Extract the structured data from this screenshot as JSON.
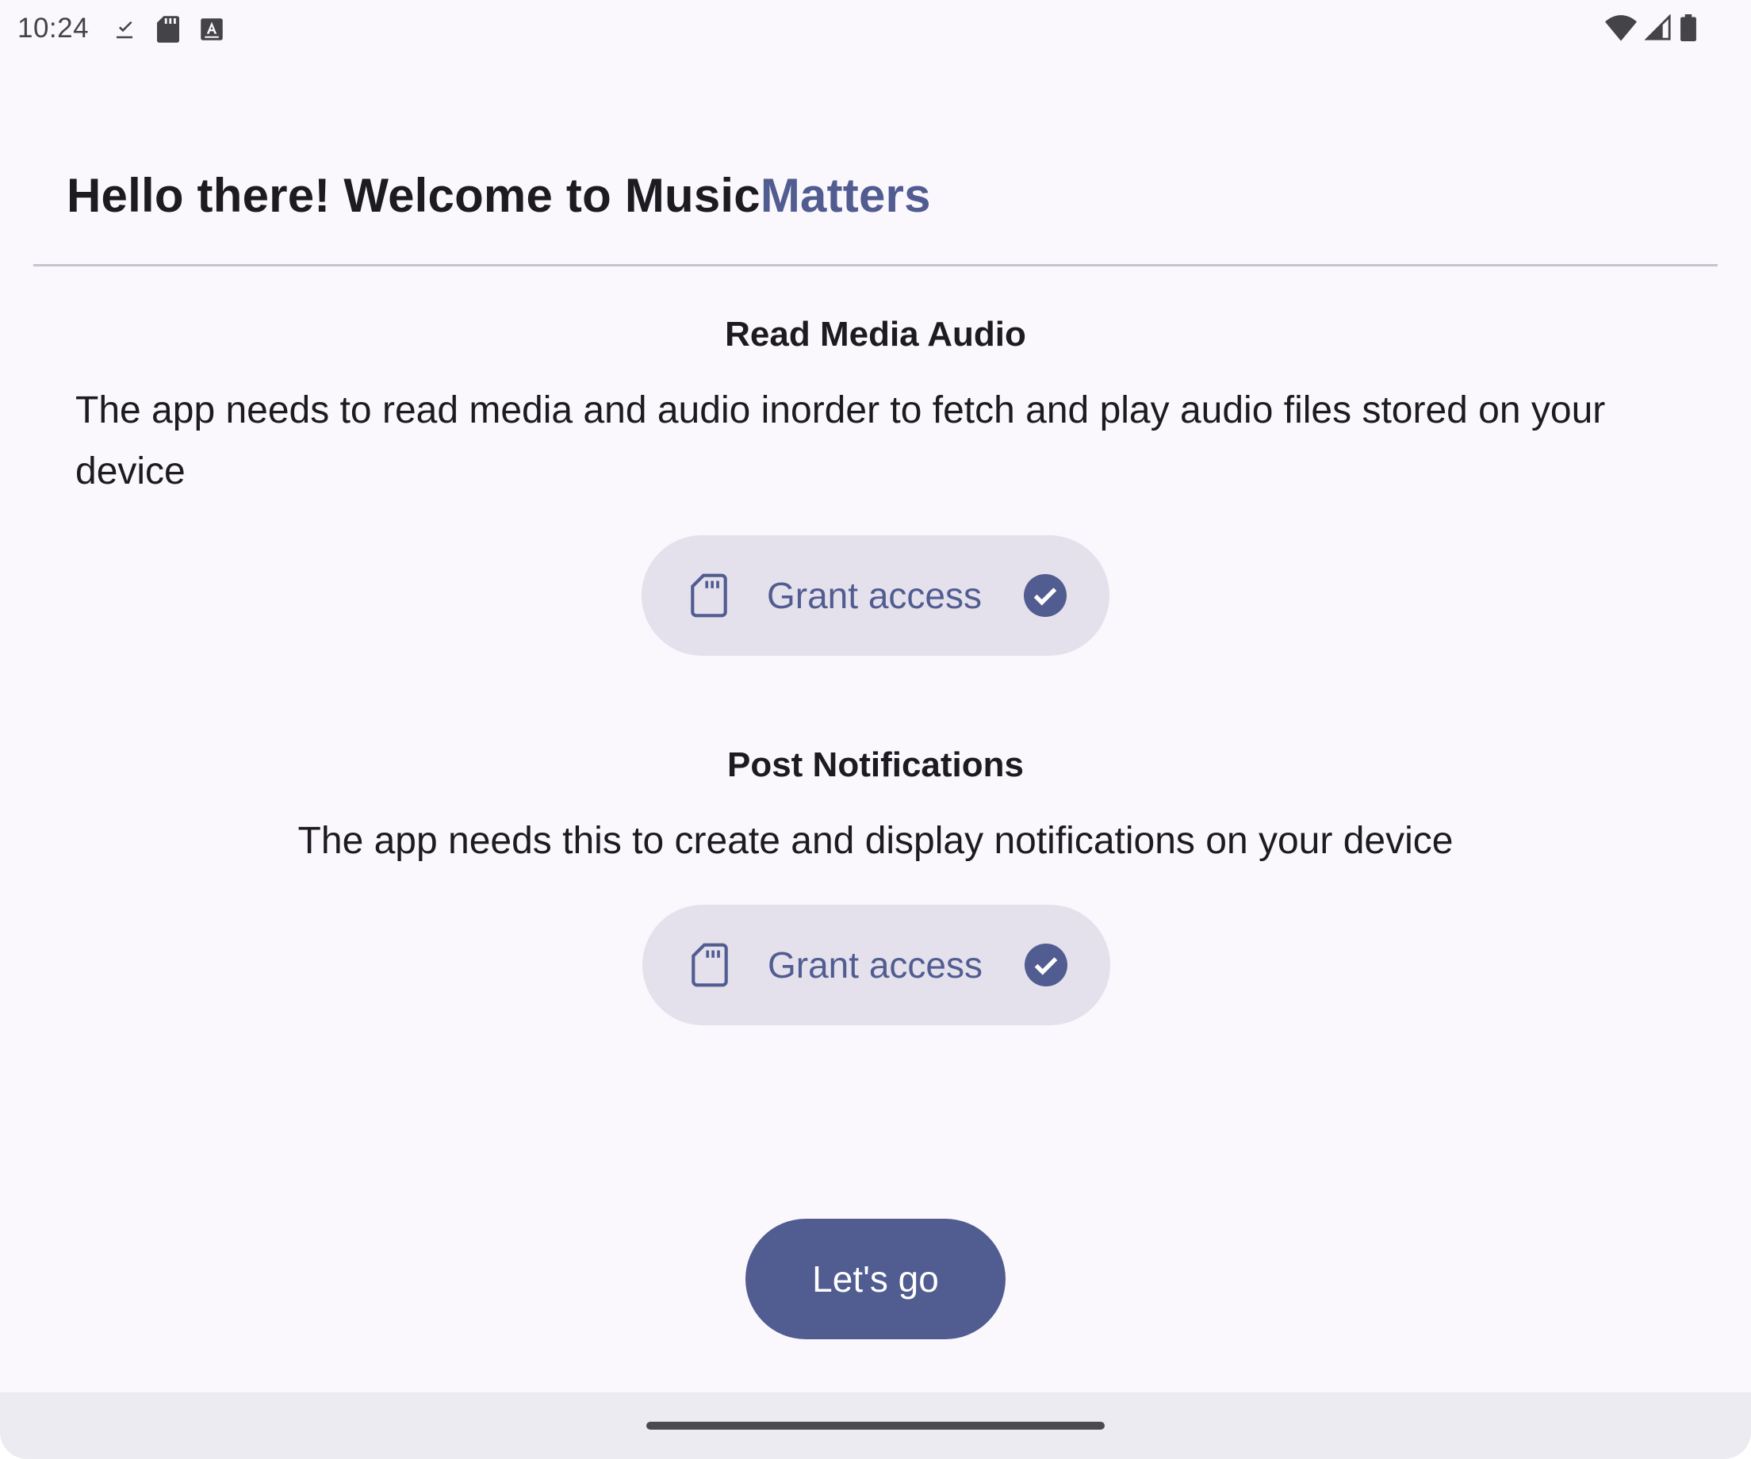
{
  "status_bar": {
    "time": "10:24",
    "left_icons": [
      "download-done-icon",
      "sd-card-icon",
      "accessibility-a-icon"
    ],
    "right_icons": [
      "wifi-icon",
      "cell-signal-icon",
      "battery-icon"
    ]
  },
  "header": {
    "title_prefix": "Hello there! Welcome to ",
    "brand_part1": "Music",
    "brand_part2": "Matters"
  },
  "sections": [
    {
      "title": "Read Media Audio",
      "description": "The app needs to read media and audio inorder to fetch and play audio files stored on your device",
      "button_label": "Grant access",
      "granted": true
    },
    {
      "title": "Post Notifications",
      "description": "The app needs this to create and display notifications on your device",
      "button_label": "Grant access",
      "granted": true
    }
  ],
  "cta": {
    "label": "Let's go"
  },
  "colors": {
    "accent": "#515c91",
    "background": "#faf7fd",
    "chip": "#e4e1ec",
    "text": "#1c1b20"
  }
}
